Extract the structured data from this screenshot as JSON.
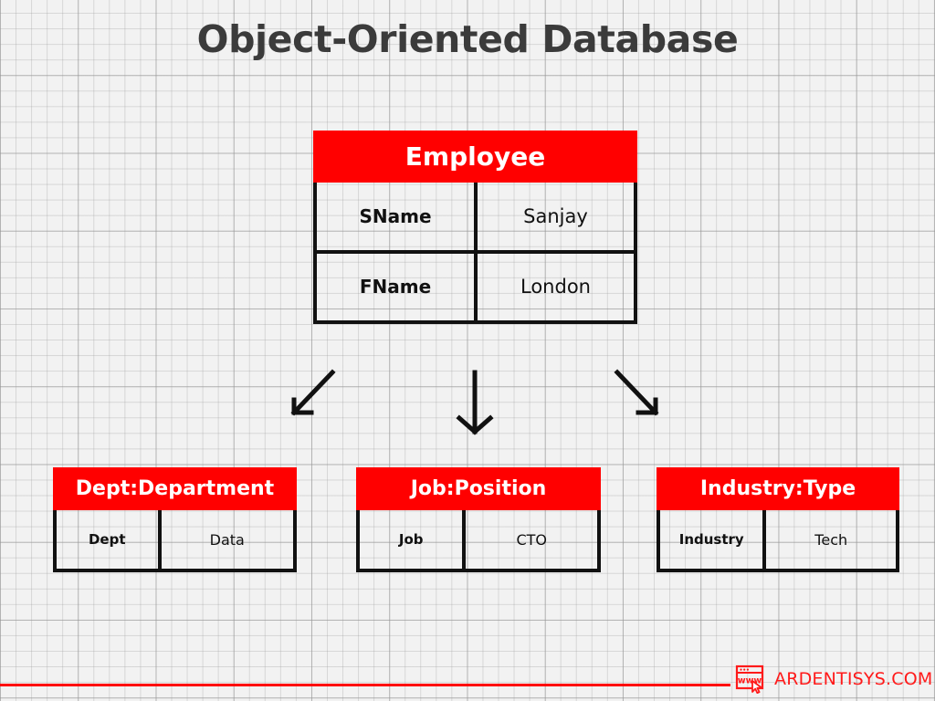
{
  "slide": {
    "title": "Object-Oriented Database",
    "background_color": "#f2f2f2",
    "accent_color": "#ff0000",
    "title_color": "#3b3b3b"
  },
  "main_entity": {
    "name": "Employee",
    "attributes": [
      {
        "key": "SName",
        "value": "Sanjay"
      },
      {
        "key": "FName",
        "value": "London"
      }
    ]
  },
  "child_entities": [
    {
      "name": "Dept:Department",
      "attributes": [
        {
          "key": "Dept",
          "value": "Data"
        }
      ]
    },
    {
      "name": "Job:Position",
      "attributes": [
        {
          "key": "Job",
          "value": "CTO"
        }
      ]
    },
    {
      "name": "Industry:Type",
      "attributes": [
        {
          "key": "Industry",
          "value": "Tech"
        }
      ]
    }
  ],
  "connectors": [
    {
      "name": "arrow-to-dept",
      "direction": "down-left"
    },
    {
      "name": "arrow-to-job",
      "direction": "down"
    },
    {
      "name": "arrow-to-industry",
      "direction": "down-right"
    }
  ],
  "footer": {
    "brand": "ARDENTISYS.COM",
    "brand_color": "#ff1a1a",
    "icon_label": "www",
    "icon_name": "browser-window-cursor-icon",
    "rule_color": "#ff0000"
  }
}
